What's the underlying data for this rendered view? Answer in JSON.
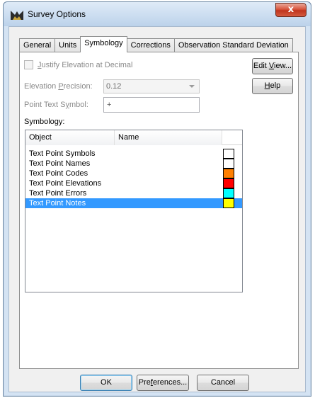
{
  "window": {
    "title": "Survey Options",
    "close_glyph": "x"
  },
  "tabs": [
    {
      "label": "General"
    },
    {
      "label": "Units"
    },
    {
      "label": "Symbology",
      "active": true
    },
    {
      "label": "Corrections"
    },
    {
      "label": "Observation Standard Deviation"
    }
  ],
  "symbology_tab": {
    "justify_elevation": {
      "label_pre": "",
      "mnemonic": "J",
      "label_post": "ustify Elevation at Decimal",
      "checked": false,
      "enabled": false
    },
    "elevation_precision": {
      "label_pre": "Elevation ",
      "mnemonic": "P",
      "label_post": "recision:",
      "value": "0.12"
    },
    "point_text_symbol": {
      "label_pre": "Point Text S",
      "mnemonic": "y",
      "label_post": "mbol:",
      "value": "+"
    },
    "symbology_label": "Symbology:",
    "list": {
      "columns": [
        {
          "label": "Object"
        },
        {
          "label": "Name"
        }
      ],
      "rows": [
        {
          "object": "Text Point Symbols",
          "color": "#ffffff"
        },
        {
          "object": "Text Point Names",
          "color": "#ffffff"
        },
        {
          "object": "Text Point Codes",
          "color": "#ff7f00"
        },
        {
          "object": "Text Point Elevations",
          "color": "#ff0000"
        },
        {
          "object": "Text Point Errors",
          "color": "#00ffff"
        },
        {
          "object": "Text Point Notes",
          "color": "#ffff00",
          "selected": true
        }
      ]
    },
    "edit_view_button": {
      "pre": "Edit ",
      "mnemonic": "V",
      "post": "iew..."
    },
    "help_button": {
      "pre": "",
      "mnemonic": "H",
      "post": "elp"
    }
  },
  "footer": {
    "ok": "OK",
    "preferences": {
      "pre": "Pre",
      "mnemonic": "f",
      "post": "erences..."
    },
    "cancel": "Cancel"
  },
  "colors": {
    "selection": "#3399ff",
    "title_bar": "#cfe0f2",
    "close_button": "#c9442c"
  }
}
